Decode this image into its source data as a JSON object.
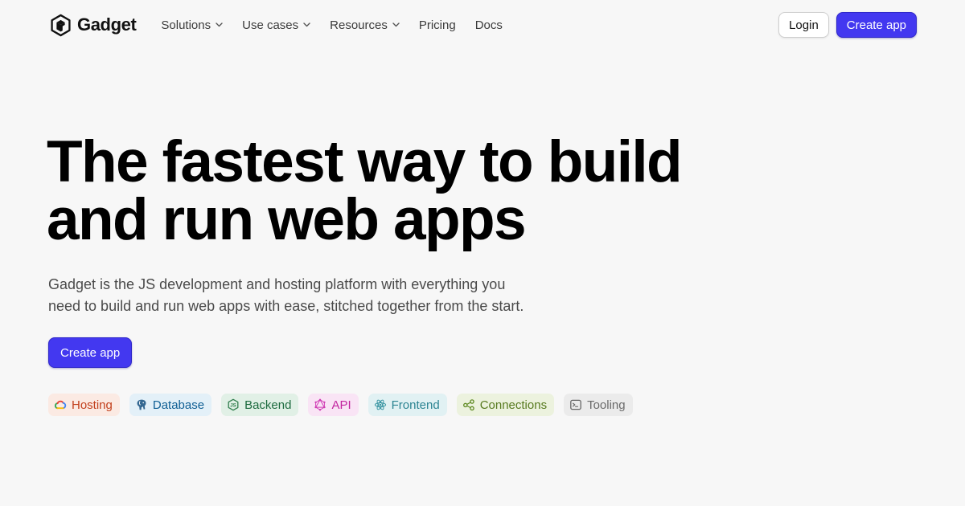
{
  "brand": {
    "name": "Gadget",
    "logo_icon": "gadget-cube-logo"
  },
  "nav": {
    "items": [
      {
        "label": "Solutions",
        "has_dropdown": true
      },
      {
        "label": "Use cases",
        "has_dropdown": true
      },
      {
        "label": "Resources",
        "has_dropdown": true
      },
      {
        "label": "Pricing",
        "has_dropdown": false
      },
      {
        "label": "Docs",
        "has_dropdown": false
      }
    ]
  },
  "header": {
    "login_label": "Login",
    "create_app_label": "Create app"
  },
  "hero": {
    "title_line1": "The fastest way to build",
    "title_line2": "and run web apps",
    "subtitle_line1": "Gadget is the JS development and hosting platform with everything you",
    "subtitle_line2": "need to build and run web apps with ease, stitched together from the start.",
    "cta_label": "Create app"
  },
  "features": [
    {
      "label": "Hosting",
      "icon": "google-cloud-icon",
      "color": "#c2401d",
      "background": "#fbeae3"
    },
    {
      "label": "Database",
      "icon": "postgres-elephant-icon",
      "color": "#0f5f94",
      "background": "#e3f0f8"
    },
    {
      "label": "Backend",
      "icon": "nodejs-icon",
      "color": "#1d6b3f",
      "background": "#e1f0e6"
    },
    {
      "label": "API",
      "icon": "graphql-icon",
      "color": "#c2259f",
      "background": "#f9e4f5"
    },
    {
      "label": "Frontend",
      "icon": "react-icon",
      "color": "#2c8492",
      "background": "#e1f1f3"
    },
    {
      "label": "Connections",
      "icon": "connections-nodes-icon",
      "color": "#577a1f",
      "background": "#ecf2de"
    },
    {
      "label": "Tooling",
      "icon": "terminal-icon",
      "color": "#6a6a6a",
      "background": "#ebebeb"
    }
  ],
  "colors": {
    "accent": "#4338f0",
    "background": "#f7f7f7",
    "title": "#000000",
    "body_text": "#4a4a4a"
  }
}
